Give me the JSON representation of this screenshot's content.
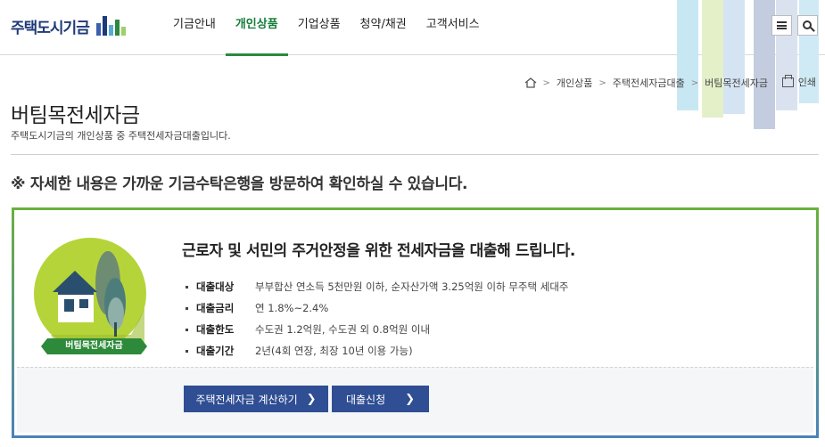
{
  "header": {
    "logo_text": "주택도시기금",
    "nav": [
      "기금안내",
      "개인상품",
      "기업상품",
      "청약/채권",
      "고객서비스"
    ],
    "active_index": 1
  },
  "breadcrumb": [
    "개인상품",
    "주택전세자금대출",
    "버팀목전세자금"
  ],
  "print_label": "인쇄",
  "page": {
    "title": "버팀목전세자금",
    "subtitle": "주택도시기금의 개인상품 중 주택전세자금대출입니다."
  },
  "notice": "※ 자세한 내용은 가까운 기금수탁은행을 방문하여 확인하실 수 있습니다.",
  "product": {
    "badge": "버팀목전세자금",
    "headline": "근로자 및 서민의 주거안정을 위한 전세자금을 대출해 드립니다.",
    "info": [
      {
        "key": "대출대상",
        "value": "부부합산 연소득 5천만원 이하, 순자산가액 3.25억원 이하 무주택 세대주"
      },
      {
        "key": "대출금리",
        "value": "연 1.8%~2.4%"
      },
      {
        "key": "대출한도",
        "value": "수도권 1.2억원, 수도권 외 0.8억원 이내"
      },
      {
        "key": "대출기간",
        "value": "2년(4회 연장, 최장 10년 이용 가능)"
      }
    ]
  },
  "buttons": {
    "calc": "주택전세자금 계산하기",
    "apply": "대출신청"
  },
  "colors": {
    "brand_green": "#2b8a3e",
    "brand_navy": "#2f4e93",
    "logo_navy": "#1e3a78"
  }
}
